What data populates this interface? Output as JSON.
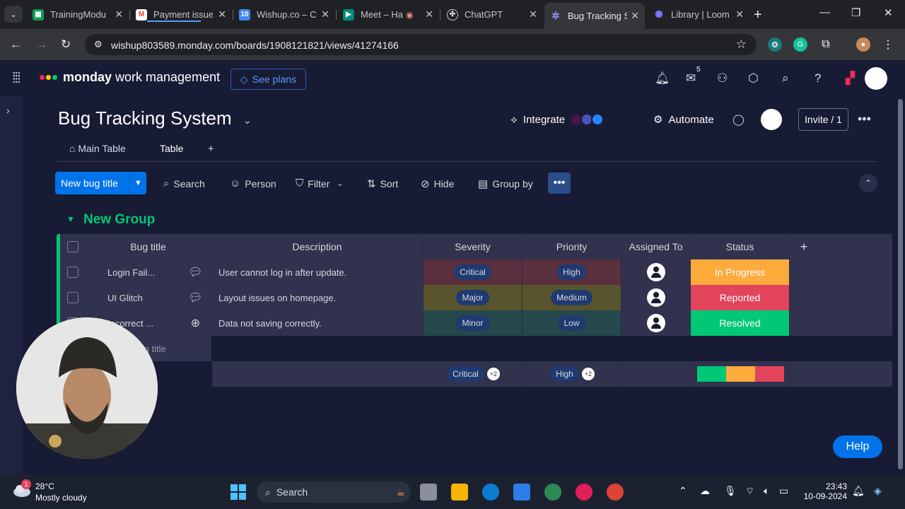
{
  "browser": {
    "tabs": [
      {
        "title": "TrainingModu",
        "favicon": "sheets-icon",
        "color": "#0f9d58"
      },
      {
        "title": "Payment issue",
        "favicon": "gmail-icon",
        "color": "#ea4335"
      },
      {
        "title": "Wishup.co – C",
        "favicon": "calendar-icon",
        "color": "#4285f4"
      },
      {
        "title": "Meet – Ha",
        "favicon": "meet-icon",
        "color": "#00897b"
      },
      {
        "title": "ChatGPT",
        "favicon": "chatgpt-icon",
        "color": "#74aa9c"
      },
      {
        "title": "Bug Tracking S",
        "favicon": "monday-icon",
        "color": "#6161ff"
      },
      {
        "title": "Library | Loom",
        "favicon": "loom-icon",
        "color": "#625df5"
      }
    ],
    "url": "wishup803589.monday.com/boards/1908121821/views/41274166"
  },
  "monday": {
    "brand_bold": "monday",
    "brand_rest": " work management",
    "see_plans": "See plans",
    "inbox_count": "5"
  },
  "board": {
    "title": "Bug Tracking System",
    "integrate": "Integrate",
    "automate": "Automate",
    "invite": "Invite / 1",
    "views": [
      "Main Table",
      "Table"
    ],
    "new_item": "New bug title",
    "actions": {
      "search": "Search",
      "person": "Person",
      "filter": "Filter",
      "sort": "Sort",
      "hide": "Hide",
      "group_by": "Group by"
    }
  },
  "group": {
    "title": "New Group",
    "columns": [
      "Bug title",
      "Description",
      "Severity",
      "Priority",
      "Assigned To",
      "Status"
    ],
    "rows": [
      {
        "title": "Login Fail...",
        "description": "User cannot log in after update.",
        "severity": "Critical",
        "priority": "High",
        "status": "In Progress",
        "status_color": "#fdab3d",
        "sev_bg": "#5a2f3e",
        "pri_bg": "#5a2f3e"
      },
      {
        "title": "UI Glitch",
        "description": "Layout issues on homepage.",
        "severity": "Major",
        "priority": "Medium",
        "status": "Reported",
        "status_color": "#e2445c",
        "sev_bg": "#58542d",
        "pri_bg": "#58542d"
      },
      {
        "title": "Incorrect ...",
        "description": "Data not saving correctly.",
        "severity": "Minor",
        "priority": "Low",
        "status": "Resolved",
        "status_color": "#00c875",
        "sev_bg": "#24484c",
        "pri_bg": "#24484c"
      }
    ],
    "add_item": "+ Add bug title",
    "summary": {
      "severity": "Critical",
      "severity_more": "+2",
      "priority": "High",
      "priority_more": "+2"
    }
  },
  "help": "Help",
  "taskbar": {
    "temp": "28°C",
    "weather": "Mostly cloudy",
    "weather_badge": "1",
    "search": "Search",
    "time": "23:43",
    "date": "10-09-2024"
  }
}
